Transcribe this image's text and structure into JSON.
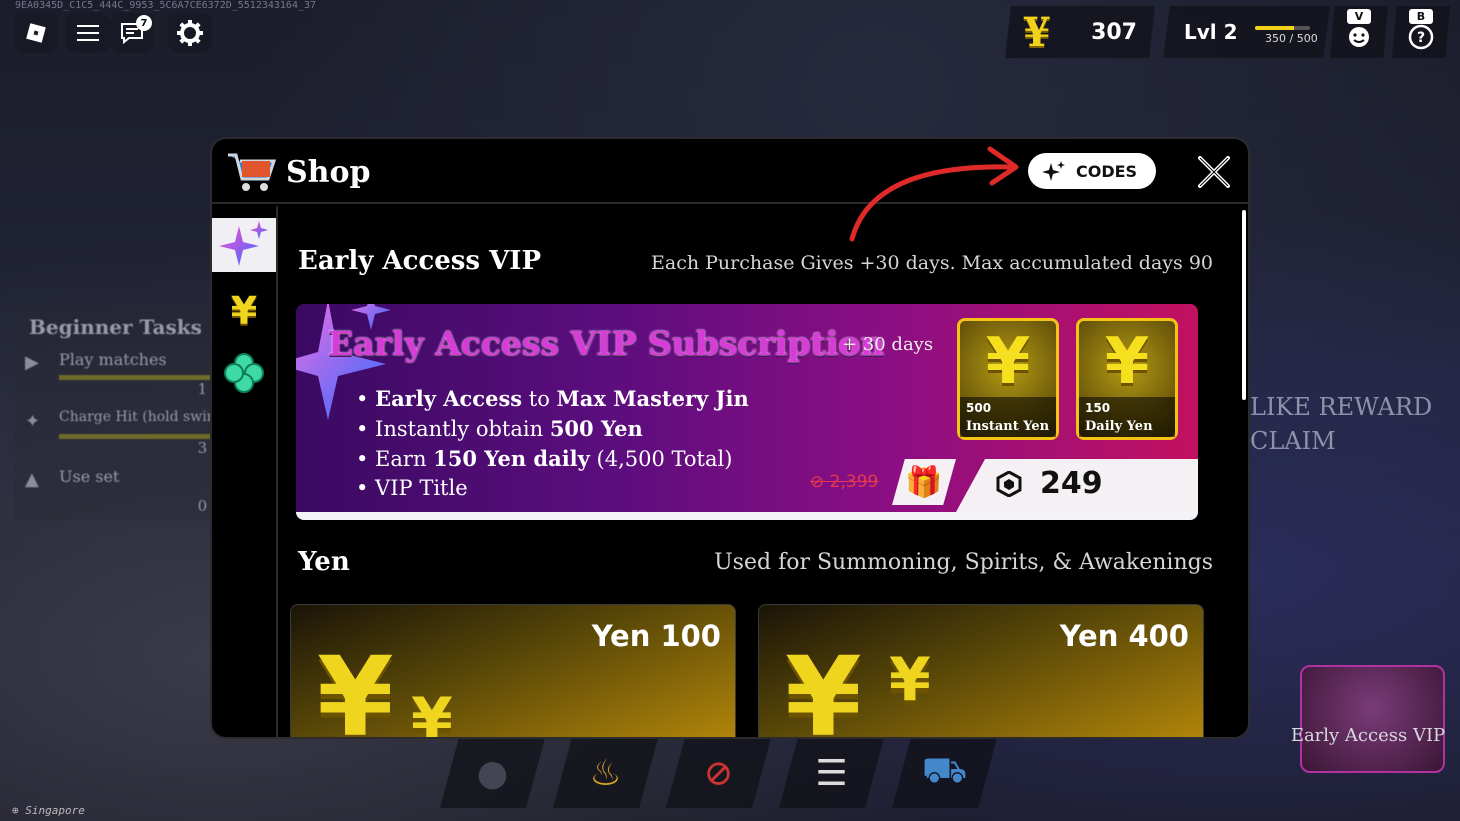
{
  "session_id": "9EA0345D_C1C5_444C_9953_5C6A7CE6372D_5512343164_37",
  "hud": {
    "chat_badge": "7",
    "yen_amount": "307",
    "level_label": "Lvl 2",
    "xp_text": "350 / 500",
    "xp_fraction": 0.7,
    "key_v": "V",
    "key_b": "B"
  },
  "tasks": {
    "title": "Beginner Tasks",
    "items": [
      {
        "name": "Play matches",
        "count": "1 /"
      },
      {
        "name": "Charge Hit (hold swing",
        "count": "3 /"
      },
      {
        "name": "Use set",
        "count": "0 /"
      }
    ]
  },
  "background": {
    "like_reward": "LIKE REWARD",
    "claim": "CLAIM",
    "vip_button": "Early Access VIP",
    "region": "Singapore"
  },
  "shop": {
    "title": "Shop",
    "codes_label": "CODES",
    "vip_section": {
      "title": "Early Access VIP",
      "subtitle": "Each Purchase Gives +30 days. Max accumulated days 90",
      "card_title": "Early Access VIP Subscription",
      "days": "+ 30 days",
      "perks": [
        {
          "pre": "• ",
          "bold1": "Early Access",
          "mid": " to ",
          "bold2": "Max Mastery Jin",
          "post": ""
        },
        {
          "pre": "• Instantly obtain ",
          "bold1": "500 Yen",
          "mid": "",
          "bold2": "",
          "post": ""
        },
        {
          "pre": "• Earn ",
          "bold1": "150 Yen daily",
          "mid": " (4,500 Total)",
          "bold2": "",
          "post": ""
        },
        {
          "pre": "• VIP Title",
          "bold1": "",
          "mid": "",
          "bold2": "",
          "post": ""
        }
      ],
      "rewards": [
        {
          "amount": "500",
          "label": "Instant Yen"
        },
        {
          "amount": "150",
          "label": "Daily Yen"
        }
      ],
      "old_price": "2,399",
      "price": "249"
    },
    "yen_section": {
      "title": "Yen",
      "subtitle": "Used for Summoning, Spirits, & Awakenings",
      "packs": [
        {
          "label": "Yen 100"
        },
        {
          "label": "Yen 400"
        }
      ]
    }
  },
  "colors": {
    "accent_gold": "#f2d21a",
    "vip_pink": "#d93bd8",
    "price_red": "#e53a4d"
  }
}
